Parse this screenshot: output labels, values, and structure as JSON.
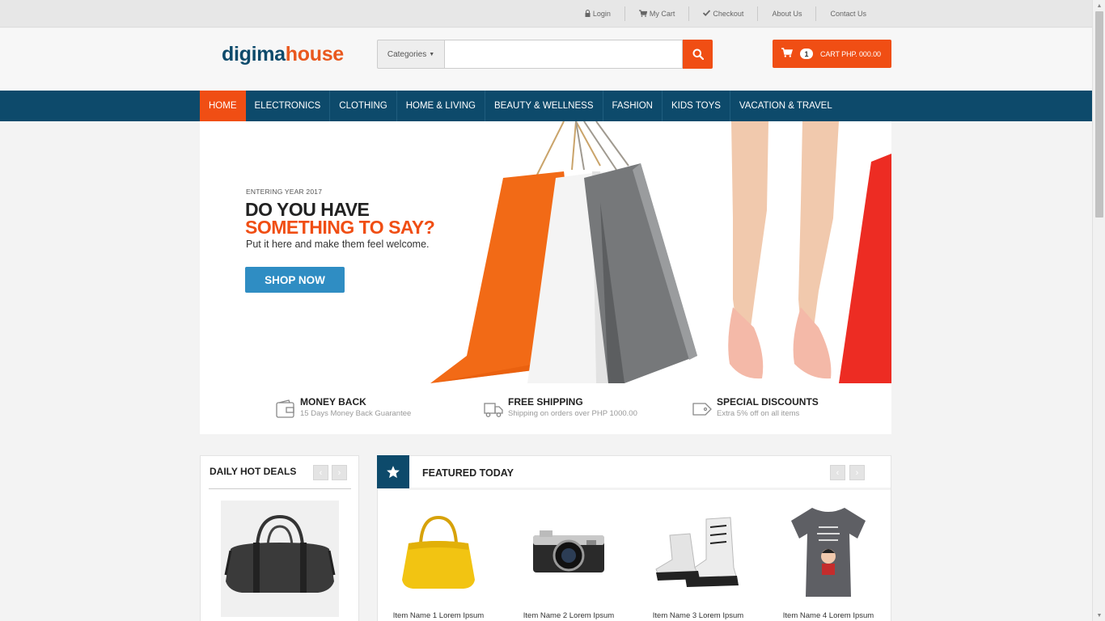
{
  "topbar": {
    "links": [
      {
        "label": "Login",
        "icon": "lock-icon"
      },
      {
        "label": "My Cart",
        "icon": "cart-icon"
      },
      {
        "label": "Checkout",
        "icon": "check-icon"
      },
      {
        "label": "About Us"
      },
      {
        "label": "Contact Us"
      }
    ]
  },
  "header": {
    "logo_part1": "digima",
    "logo_part2": "house",
    "categories_label": "Categories",
    "search_placeholder": "",
    "cart_count": "1",
    "cart_label": "CART PHP. 000.00"
  },
  "nav": {
    "items": [
      "HOME",
      "ELECTRONICS",
      "CLOTHING",
      "HOME & LIVING",
      "BEAUTY & WELLNESS",
      "FASHION",
      "KIDS TOYS",
      "VACATION & TRAVEL"
    ],
    "active_index": 0
  },
  "hero": {
    "subtitle": "ENTERING YEAR 2017",
    "title_line1": "DO YOU HAVE",
    "title_line2": "SOMETHING TO SAY?",
    "description": "Put it here and make them feel welcome.",
    "button": "SHOP NOW"
  },
  "features": [
    {
      "title": "MONEY BACK",
      "desc": "15 Days Money Back Guarantee",
      "icon": "wallet-icon"
    },
    {
      "title": "FREE SHIPPING",
      "desc": "Shipping on orders over PHP 1000.00",
      "icon": "truck-icon"
    },
    {
      "title": "SPECIAL DISCOUNTS",
      "desc": "Extra 5% off on all items",
      "icon": "tag-icon"
    }
  ],
  "deals": {
    "title": "DAILY HOT DEALS"
  },
  "featured": {
    "title": "FEATURED TODAY",
    "products": [
      {
        "name": "Item Name 1 Lorem Ipsum"
      },
      {
        "name": "Item Name 2 Lorem Ipsum"
      },
      {
        "name": "Item Name 3 Lorem Ipsum"
      },
      {
        "name": "Item Name 4 Lorem Ipsum"
      }
    ]
  },
  "colors": {
    "brand_blue": "#0d4a6b",
    "accent_orange": "#f04e14",
    "button_blue": "#2f8dc3"
  }
}
